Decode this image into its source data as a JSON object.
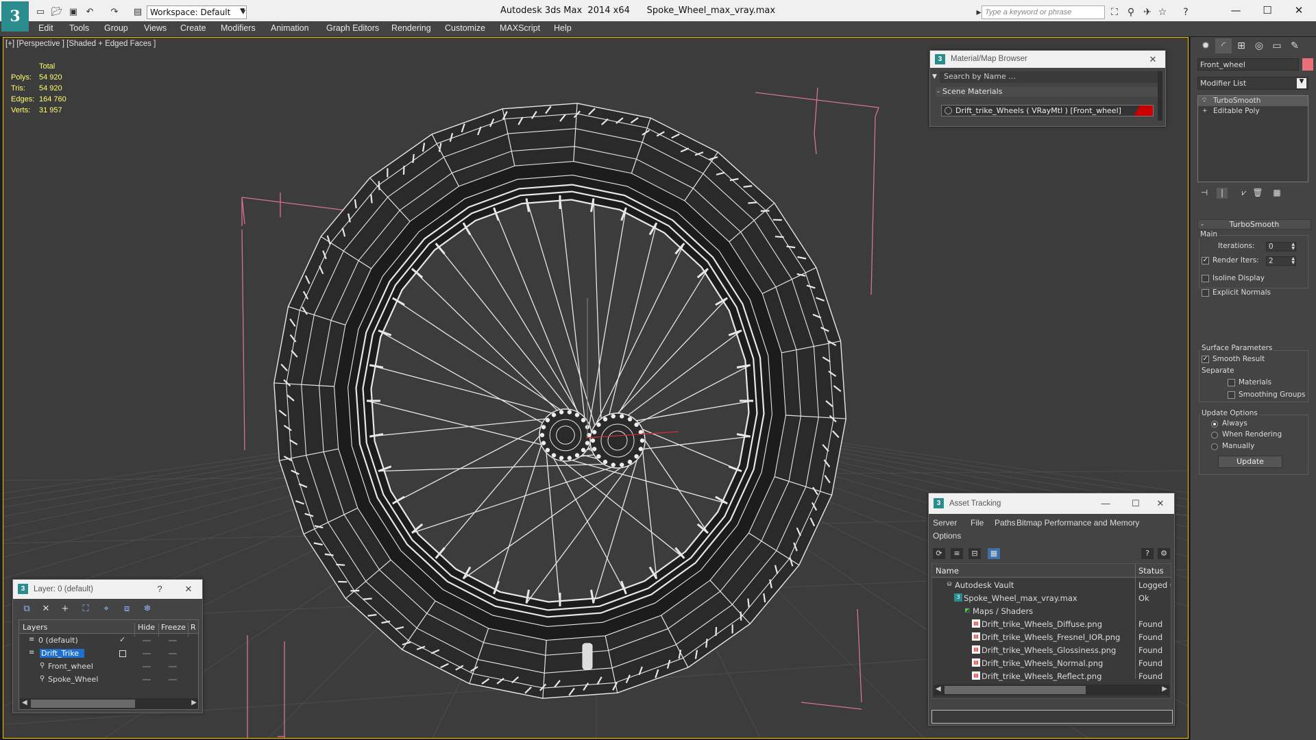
{
  "titlebar": {
    "workspace": "Workspace: Default",
    "app_title": "Autodesk 3ds Max  2014 x64      Spoke_Wheel_max_vray.max",
    "search_placeholder": "Type a keyword or phrase"
  },
  "menu": [
    "Edit",
    "Tools",
    "Group",
    "Views",
    "Create",
    "Modifiers",
    "Animation",
    "Graph Editors",
    "Rendering",
    "Customize",
    "MAXScript",
    "Help"
  ],
  "viewport": {
    "label": "[+] [Perspective ] [Shaded + Edged Faces ]",
    "stats": {
      "header": "Total",
      "rows": [
        {
          "label": "Polys:",
          "value": "54 920"
        },
        {
          "label": "Tris:",
          "value": "54 920"
        },
        {
          "label": "Edges:",
          "value": "164 760"
        },
        {
          "label": "Verts:",
          "value": "31 957"
        }
      ]
    }
  },
  "command_panel": {
    "object_name": "Front_wheel",
    "object_color": "#e8707a",
    "modifier_list": "Modifier List",
    "stack": [
      {
        "label": "TurboSmooth",
        "icon": "lightbulb-icon",
        "selected": true
      },
      {
        "label": "Editable Poly",
        "icon": "plus-icon",
        "selected": false
      }
    ],
    "turbosmooth": {
      "title": "TurboSmooth",
      "main_label": "Main",
      "iterations_label": "Iterations:",
      "iterations_value": "0",
      "render_iters_label": "Render Iters:",
      "render_iters_value": "2",
      "isoline": "Isoline Display",
      "explicit_normals": "Explicit Normals",
      "surface_params": "Surface Parameters",
      "smooth_result": "Smooth Result",
      "separate": "Separate",
      "materials": "Materials",
      "smoothing_groups": "Smoothing Groups",
      "update_options": "Update Options",
      "always": "Always",
      "when_rendering": "When Rendering",
      "manually": "Manually",
      "update_button": "Update"
    }
  },
  "material_browser": {
    "title": "Material/Map Browser",
    "search_placeholder": "Search by Name ...",
    "section": "Scene Materials",
    "item": "Drift_trike_Wheels  ( VRayMtl )  [Front_wheel]"
  },
  "asset_tracking": {
    "title": "Asset Tracking",
    "menu": [
      "Server",
      "File",
      "Paths",
      "Bitmap Performance and Memory",
      "Options"
    ],
    "columns": [
      "Name",
      "Status"
    ],
    "rows": [
      {
        "name": "Autodesk Vault",
        "status": "Logged O",
        "indent": 1,
        "icon": "vault-icon"
      },
      {
        "name": "Spoke_Wheel_max_vray.max",
        "status": "Ok",
        "indent": 2,
        "icon": "max-file-icon"
      },
      {
        "name": "Maps / Shaders",
        "status": "",
        "indent": 3,
        "icon": "maps-icon"
      },
      {
        "name": "Drift_trike_Wheels_Diffuse.png",
        "status": "Found",
        "indent": 4,
        "icon": "png-icon"
      },
      {
        "name": "Drift_trike_Wheels_Fresnel_IOR.png",
        "status": "Found",
        "indent": 4,
        "icon": "png-icon"
      },
      {
        "name": "Drift_trike_Wheels_Glossiness.png",
        "status": "Found",
        "indent": 4,
        "icon": "png-icon"
      },
      {
        "name": "Drift_trike_Wheels_Normal.png",
        "status": "Found",
        "indent": 4,
        "icon": "png-icon"
      },
      {
        "name": "Drift_trike_Wheels_Reflect.png",
        "status": "Found",
        "indent": 4,
        "icon": "png-icon"
      }
    ]
  },
  "layers": {
    "title": "Layer: 0 (default)",
    "columns": [
      "Layers",
      "Hide",
      "Freeze",
      "R"
    ],
    "rows": [
      {
        "name": "0 (default)",
        "indent": 1,
        "selected": false
      },
      {
        "name": "Drift_Trike",
        "indent": 1,
        "selected": true
      },
      {
        "name": "Front_wheel",
        "indent": 2,
        "selected": false
      },
      {
        "name": "Spoke_Wheel",
        "indent": 2,
        "selected": false
      }
    ]
  }
}
